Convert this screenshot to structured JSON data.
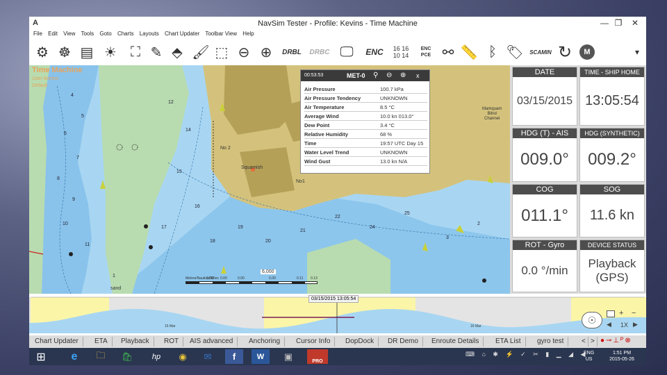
{
  "window": {
    "title": "NavSim Tester - Profile: Kevins - Time Machine",
    "icon": "A",
    "minimize": "—",
    "restore": "❐",
    "close": "✕"
  },
  "menu": [
    "File",
    "Edit",
    "View",
    "Tools",
    "Goto",
    "Charts",
    "Layouts",
    "Chart Updater",
    "Toolbar View",
    "Help"
  ],
  "toolbar": {
    "drbl": "DRBL",
    "drbc": "DRBC",
    "enc": "ENC",
    "scamin": "SCAMIN",
    "badge": "M",
    "scale_top": "16",
    "scale_top2": "16",
    "scale_bottom": "10",
    "scale_bottom2": "14",
    "enc_small": "ENC",
    "pce": "PCE"
  },
  "chart": {
    "overlay_title": "Time Machine",
    "overlay_line1": "User Anchor",
    "overlay_line2": "Default",
    "label_squamish": "Squamish",
    "label_no2": "No 2",
    "label_no1": "No1",
    "label_sand": "sand",
    "label_mamquam1": "Mamquam",
    "label_mamquam2": "Blind",
    "label_mamquam3": "Channel",
    "scale_title": "Metres/Nautical Miles",
    "scale_ticks": [
      "0.00",
      "0.00",
      "0.00",
      "0.00",
      "0.11",
      "0.13"
    ],
    "scale_value": "6,000",
    "soundings": [
      "4",
      "5",
      "6",
      "7",
      "8",
      "9",
      "10",
      "11",
      "12",
      "14",
      "15",
      "16",
      "17",
      "18",
      "19",
      "20",
      "21",
      "22",
      "24",
      "25",
      "3",
      "2",
      "1"
    ]
  },
  "met_popup": {
    "time": "00:53:53",
    "title": "MET-0",
    "close": "x",
    "rows": [
      {
        "k": "Air Pressure",
        "v": "100.7 kPa"
      },
      {
        "k": "Air Pressure Tendency",
        "v": "UNKNOWN"
      },
      {
        "k": "Air Temperature",
        "v": "8.5 °C"
      },
      {
        "k": "Average Wind",
        "v": "10.0 kn 013.0°"
      },
      {
        "k": "Dew Point",
        "v": "3.4 °C"
      },
      {
        "k": "Relative Humidity",
        "v": "68 %"
      },
      {
        "k": "Time",
        "v": "19:57 UTC Day 15"
      },
      {
        "k": "Water Level Trend",
        "v": "UNKNOWN"
      },
      {
        "k": "Wind Gust",
        "v": "13.0 kn N/A"
      }
    ]
  },
  "panel": {
    "date_hdr": "DATE",
    "date_val": "03/15/2015",
    "time_hdr": "TIME - SHIP HOME",
    "time_val": "13:05:54",
    "hdg_hdr": "HDG (T) - AIS",
    "hdg_val": "009.0°",
    "hdgs_hdr": "HDG (SYNTHETIC)",
    "hdgs_val": "009.2°",
    "cog_hdr": "COG",
    "cog_val": "011.1°",
    "sog_hdr": "SOG",
    "sog_val": "11.6 kn",
    "rot_hdr": "ROT - Gyro",
    "rot_val": "0.0 °/min",
    "dev_hdr": "DEVICE STATUS",
    "dev_val": "Playback (GPS)"
  },
  "timeline": {
    "cursor_label": "03/15/2015 13:05:54",
    "date_left": "15 Mar",
    "date_right": "16 Mar",
    "speed": "1X"
  },
  "tabs": [
    "Chart Updater",
    "ETA",
    "Playback",
    "ROT",
    "AIS advanced",
    "Anchoring",
    "Cursor Info",
    "DopDock",
    "DR Demo",
    "Enroute Details",
    "ETA List",
    "gyro test"
  ],
  "tab_nav": {
    "prev": "<",
    "next": ">"
  },
  "taskbar": {
    "lang1": "ENG",
    "lang2": "US",
    "time": "1:51 PM",
    "date": "2015-05-26",
    "pro": "PRO"
  },
  "colors": {
    "water": "#a8d6f2",
    "deep_water": "#7cbbe8",
    "land": "#d4c27c",
    "built": "#b5a058",
    "tideflat": "#b8dcb0",
    "header": "#4d4d4d"
  }
}
